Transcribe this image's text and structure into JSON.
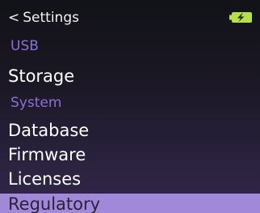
{
  "header": {
    "back_chevron": "<",
    "back_label": "Settings",
    "battery_icon": "battery-charging-icon",
    "battery_color": "#b4e04a"
  },
  "sections": {
    "usb": "USB",
    "system": "System"
  },
  "items": {
    "storage": "Storage",
    "database": "Database",
    "firmware": "Firmware",
    "licenses": "Licenses",
    "regulatory": "Regulatory"
  },
  "colors": {
    "section_header": "#8f6fd6",
    "selected_background": "#a288d8"
  }
}
